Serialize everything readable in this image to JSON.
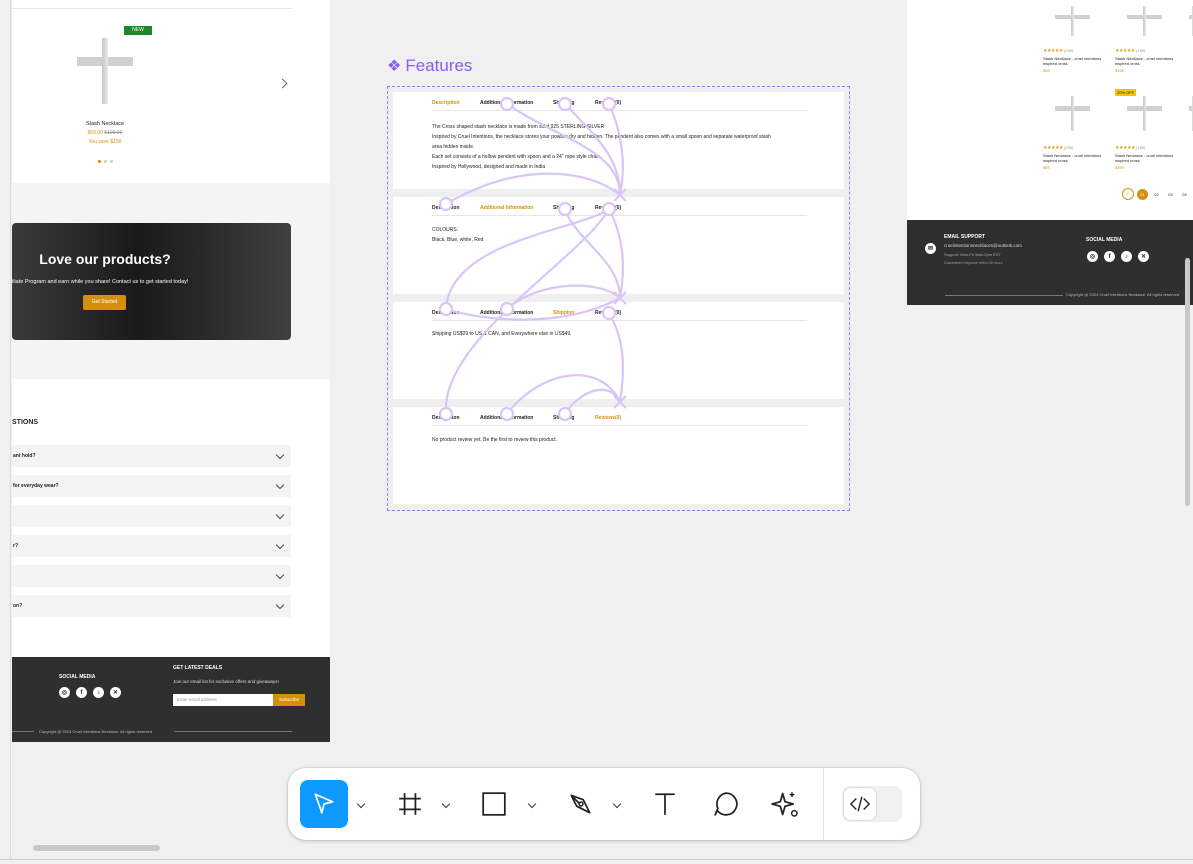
{
  "left_frame": {
    "product": {
      "badge": "NEW",
      "name": "Stash Necklace",
      "price": "$59.00",
      "old_price": "$199.00",
      "save": "You save $150"
    },
    "promo": {
      "title": "Love our products?",
      "subtitle": "iliate Program and earn while you share! Contact us to get started today!",
      "button": "Get Started"
    },
    "faq": {
      "heading": "STIONS",
      "items": [
        "ant hold?",
        "for everyday wear?",
        "",
        "r?",
        "",
        "on?"
      ]
    },
    "footer": {
      "social_title": "SOCIAL MEDIA",
      "deals_title": "GET LATEST DEALS",
      "deals_text": "Join our email list for exclusive offers and giveaways!",
      "email_placeholder": "Enter email address",
      "subscribe": "Subscribe",
      "copyright": "Copyright @ 2024 Cruel Intentions Necklace. All rights reserved"
    }
  },
  "features": {
    "title": "Features",
    "cards": [
      {
        "tabs": [
          "Description",
          "Additional Information",
          "Shipping",
          "Reviews(0)"
        ],
        "active": 0,
        "lines": [
          "The Cross shaped stash necklace is made from solid 925 STERLING SILVER",
          "Inspired by Cruel Intentions, the necklace stores your powder dry and hidden. The pendent also comes with a small spoon and separate waterproof stash",
          "area hidden inside.",
          "Each set consists of a hollow pendent with spoon and a 24\" rope style chain",
          "Inspired by Hollywood, designed and made in India"
        ]
      },
      {
        "tabs": [
          "Description",
          "Additional Information",
          "Shipping",
          "Reviews(0)"
        ],
        "active": 1,
        "lines": [
          "COLOURS:",
          "Black, Blue, white, Red"
        ]
      },
      {
        "tabs": [
          "Description",
          "Additional Information",
          "Shipping",
          "Reviews(0)"
        ],
        "active": 2,
        "lines": [
          "Shipping US$29 to US & CAN, and Everywhere else in US$49."
        ]
      },
      {
        "tabs": [
          "Description",
          "Additional Information",
          "Shipping",
          "Reviews(0)"
        ],
        "active": 3,
        "lines": [
          "No product review yet. Be the first to review this product."
        ]
      }
    ]
  },
  "right_frame": {
    "products": [
      {
        "stars": "★★★★★",
        "reviews": "(239)",
        "name": "Stash Necklace - cruel intentions inspired cross",
        "price": "$59"
      },
      {
        "stars": "★★★★★",
        "reviews": "(189)",
        "name": "Stash Necklace - cruel intentions inspired cross",
        "price": "$399"
      },
      {
        "stars": "★★★★★",
        "reviews": "(239)",
        "name": "Stash Necklace - cruel intentions inspired cross",
        "price": "$59",
        "badge": ""
      },
      {
        "stars": "★★★★★",
        "reviews": "(189)",
        "name": "Stash Necklace - cruel intentions inspired cross",
        "price": "$399",
        "badge": "20% OFF"
      }
    ],
    "pagination": [
      "01",
      "02",
      "03",
      "04"
    ],
    "footer": {
      "email_title": "EMAIL SUPPORT",
      "email": "cruelintentionsnecklaces@outlook.com",
      "support": "Support: Mon-Fri 9am-2pm EST",
      "response": "Guaranteed response within 48 hours",
      "social_title": "SOCIAL MEDIA",
      "copyright": "Copyright @ 2024 Cruel Intentions Necklace. All rights reserved"
    }
  },
  "toolbar": {
    "tools": [
      "move-tool",
      "frame-tool",
      "shape-tool",
      "pen-tool",
      "text-tool",
      "comment-tool",
      "ai-tool",
      "dev-mode-toggle"
    ],
    "accent": "#0d99ff"
  },
  "colors": {
    "accent_orange": "#d4900c",
    "connector_purple": "#d7c2f7",
    "selection_border": "#9b7bea"
  }
}
